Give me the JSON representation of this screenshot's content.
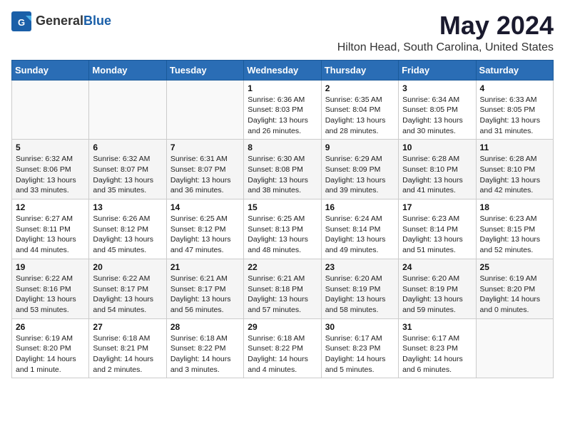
{
  "header": {
    "logo_general": "General",
    "logo_blue": "Blue",
    "title": "May 2024",
    "subtitle": "Hilton Head, South Carolina, United States"
  },
  "weekdays": [
    "Sunday",
    "Monday",
    "Tuesday",
    "Wednesday",
    "Thursday",
    "Friday",
    "Saturday"
  ],
  "weeks": [
    [
      {
        "day": "",
        "content": ""
      },
      {
        "day": "",
        "content": ""
      },
      {
        "day": "",
        "content": ""
      },
      {
        "day": "1",
        "content": "Sunrise: 6:36 AM\nSunset: 8:03 PM\nDaylight: 13 hours\nand 26 minutes."
      },
      {
        "day": "2",
        "content": "Sunrise: 6:35 AM\nSunset: 8:04 PM\nDaylight: 13 hours\nand 28 minutes."
      },
      {
        "day": "3",
        "content": "Sunrise: 6:34 AM\nSunset: 8:05 PM\nDaylight: 13 hours\nand 30 minutes."
      },
      {
        "day": "4",
        "content": "Sunrise: 6:33 AM\nSunset: 8:05 PM\nDaylight: 13 hours\nand 31 minutes."
      }
    ],
    [
      {
        "day": "5",
        "content": "Sunrise: 6:32 AM\nSunset: 8:06 PM\nDaylight: 13 hours\nand 33 minutes."
      },
      {
        "day": "6",
        "content": "Sunrise: 6:32 AM\nSunset: 8:07 PM\nDaylight: 13 hours\nand 35 minutes."
      },
      {
        "day": "7",
        "content": "Sunrise: 6:31 AM\nSunset: 8:07 PM\nDaylight: 13 hours\nand 36 minutes."
      },
      {
        "day": "8",
        "content": "Sunrise: 6:30 AM\nSunset: 8:08 PM\nDaylight: 13 hours\nand 38 minutes."
      },
      {
        "day": "9",
        "content": "Sunrise: 6:29 AM\nSunset: 8:09 PM\nDaylight: 13 hours\nand 39 minutes."
      },
      {
        "day": "10",
        "content": "Sunrise: 6:28 AM\nSunset: 8:10 PM\nDaylight: 13 hours\nand 41 minutes."
      },
      {
        "day": "11",
        "content": "Sunrise: 6:28 AM\nSunset: 8:10 PM\nDaylight: 13 hours\nand 42 minutes."
      }
    ],
    [
      {
        "day": "12",
        "content": "Sunrise: 6:27 AM\nSunset: 8:11 PM\nDaylight: 13 hours\nand 44 minutes."
      },
      {
        "day": "13",
        "content": "Sunrise: 6:26 AM\nSunset: 8:12 PM\nDaylight: 13 hours\nand 45 minutes."
      },
      {
        "day": "14",
        "content": "Sunrise: 6:25 AM\nSunset: 8:12 PM\nDaylight: 13 hours\nand 47 minutes."
      },
      {
        "day": "15",
        "content": "Sunrise: 6:25 AM\nSunset: 8:13 PM\nDaylight: 13 hours\nand 48 minutes."
      },
      {
        "day": "16",
        "content": "Sunrise: 6:24 AM\nSunset: 8:14 PM\nDaylight: 13 hours\nand 49 minutes."
      },
      {
        "day": "17",
        "content": "Sunrise: 6:23 AM\nSunset: 8:14 PM\nDaylight: 13 hours\nand 51 minutes."
      },
      {
        "day": "18",
        "content": "Sunrise: 6:23 AM\nSunset: 8:15 PM\nDaylight: 13 hours\nand 52 minutes."
      }
    ],
    [
      {
        "day": "19",
        "content": "Sunrise: 6:22 AM\nSunset: 8:16 PM\nDaylight: 13 hours\nand 53 minutes."
      },
      {
        "day": "20",
        "content": "Sunrise: 6:22 AM\nSunset: 8:17 PM\nDaylight: 13 hours\nand 54 minutes."
      },
      {
        "day": "21",
        "content": "Sunrise: 6:21 AM\nSunset: 8:17 PM\nDaylight: 13 hours\nand 56 minutes."
      },
      {
        "day": "22",
        "content": "Sunrise: 6:21 AM\nSunset: 8:18 PM\nDaylight: 13 hours\nand 57 minutes."
      },
      {
        "day": "23",
        "content": "Sunrise: 6:20 AM\nSunset: 8:19 PM\nDaylight: 13 hours\nand 58 minutes."
      },
      {
        "day": "24",
        "content": "Sunrise: 6:20 AM\nSunset: 8:19 PM\nDaylight: 13 hours\nand 59 minutes."
      },
      {
        "day": "25",
        "content": "Sunrise: 6:19 AM\nSunset: 8:20 PM\nDaylight: 14 hours\nand 0 minutes."
      }
    ],
    [
      {
        "day": "26",
        "content": "Sunrise: 6:19 AM\nSunset: 8:20 PM\nDaylight: 14 hours\nand 1 minute."
      },
      {
        "day": "27",
        "content": "Sunrise: 6:18 AM\nSunset: 8:21 PM\nDaylight: 14 hours\nand 2 minutes."
      },
      {
        "day": "28",
        "content": "Sunrise: 6:18 AM\nSunset: 8:22 PM\nDaylight: 14 hours\nand 3 minutes."
      },
      {
        "day": "29",
        "content": "Sunrise: 6:18 AM\nSunset: 8:22 PM\nDaylight: 14 hours\nand 4 minutes."
      },
      {
        "day": "30",
        "content": "Sunrise: 6:17 AM\nSunset: 8:23 PM\nDaylight: 14 hours\nand 5 minutes."
      },
      {
        "day": "31",
        "content": "Sunrise: 6:17 AM\nSunset: 8:23 PM\nDaylight: 14 hours\nand 6 minutes."
      },
      {
        "day": "",
        "content": ""
      }
    ]
  ]
}
